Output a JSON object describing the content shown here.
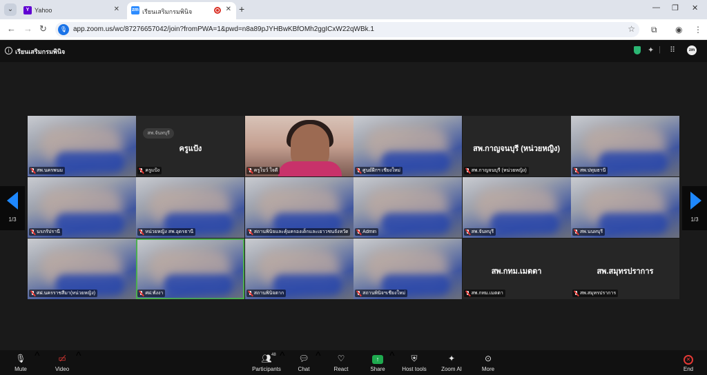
{
  "browser": {
    "tabs": [
      {
        "label": "Yahoo",
        "favicon": "Y",
        "favicon_color": "#6001d2"
      },
      {
        "label": "เรียนเสริมกรมพินิจ",
        "favicon": "zm",
        "favicon_color": "#2d8cff"
      }
    ],
    "url": "app.zoom.us/wc/87276657042/join?fromPWA=1&pwd=n8a89pJYHBwKBfOMh2ggICxW22qWBk.1"
  },
  "meeting": {
    "title": "เรียนเสริมกรมพินิจ",
    "page_indicator_left": "1/3",
    "page_indicator_right": "1/3"
  },
  "participants": [
    {
      "name": "สพ.นครพนม",
      "type": "video",
      "big_name": ""
    },
    {
      "name": "ครูแป้ง",
      "type": "avatar",
      "big_name": "ครูแป้ง",
      "pill": "สพ.จันทบุรี"
    },
    {
      "name": "ครูโบว์ ใจดี",
      "type": "self",
      "big_name": ""
    },
    {
      "name": "ศูนย์ฝึกฯ เชียงใหม่",
      "type": "video",
      "big_name": ""
    },
    {
      "name": "สพ.กาญจนบุรี (หน่วยหญิง)",
      "type": "avatar",
      "big_name": "สพ.กาญจนบุรี (หน่วยหญิง)"
    },
    {
      "name": "สพ.ปทุมธานี",
      "type": "video",
      "big_name": ""
    },
    {
      "name": "นรภรัปรานี",
      "type": "video",
      "big_name": ""
    },
    {
      "name": "หน่วยหญิง สพ.อุดรธานี",
      "type": "video",
      "big_name": ""
    },
    {
      "name": "สถานพินิจและคุ้มครองเด็กและเยาวชนจังหวัดกาฬสินธุ์",
      "type": "video",
      "big_name": ""
    },
    {
      "name": "Admin",
      "type": "video",
      "big_name": ""
    },
    {
      "name": "สพ.จันทบุรี",
      "type": "video",
      "big_name": ""
    },
    {
      "name": "สพ.นนทบุรี",
      "type": "video",
      "big_name": ""
    },
    {
      "name": "ศฝ.นครราชสีมา(หน่วยหญิง)",
      "type": "video",
      "big_name": ""
    },
    {
      "name": "ศฝ.พังงา",
      "type": "video",
      "big_name": "",
      "active": true
    },
    {
      "name": "สถานพินิจตาก",
      "type": "video",
      "big_name": ""
    },
    {
      "name": "สถานพินิจฯเชียงใหม่",
      "type": "video",
      "big_name": ""
    },
    {
      "name": "สพ.กทม.เมตตา",
      "type": "avatar",
      "big_name": "สพ.กทม.เมตตา"
    },
    {
      "name": "สพ.สมุทรปราการ",
      "type": "avatar",
      "big_name": "สพ.สมุทรปราการ"
    }
  ],
  "toolbar": {
    "mute": "Mute",
    "video": "Video",
    "participants": "Participants",
    "participants_count": "48",
    "chat": "Chat",
    "react": "React",
    "share": "Share",
    "host_tools": "Host tools",
    "zoom_ai": "Zoom AI",
    "more": "More",
    "end": "End"
  },
  "colors": {
    "accent": "#1e88ff",
    "share": "#1faa4f",
    "end": "#e53935",
    "active_speaker": "#4caf50"
  }
}
